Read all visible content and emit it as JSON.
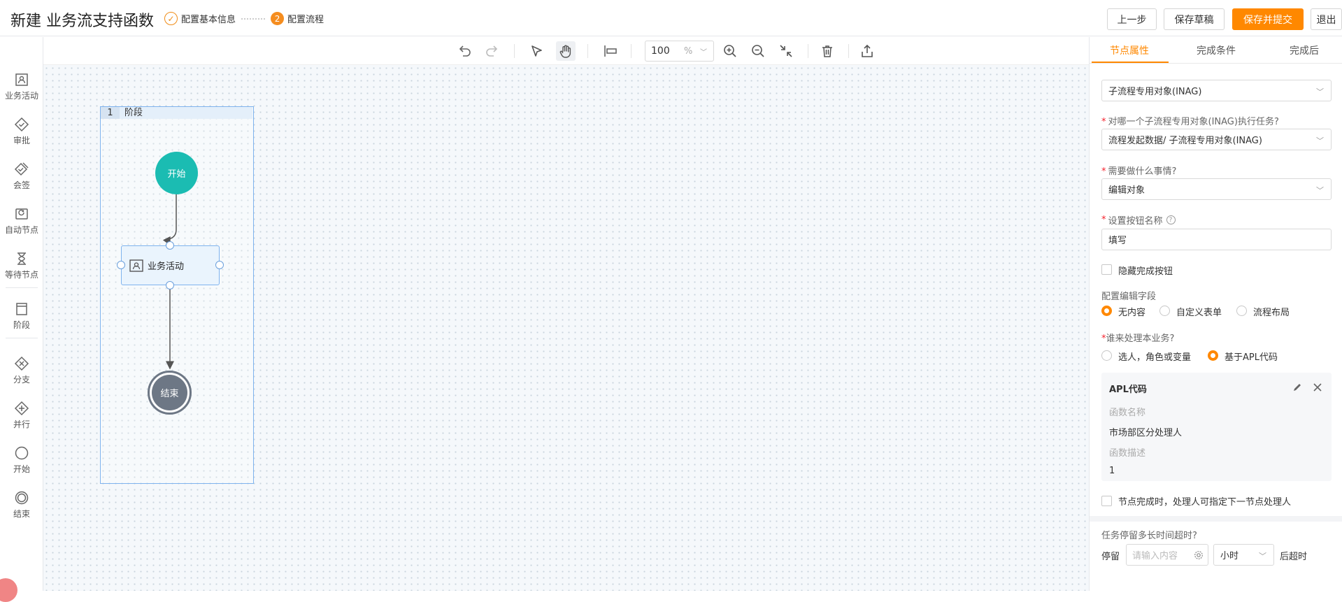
{
  "header": {
    "title": "新建 业务流支持函数",
    "steps": [
      {
        "label": "配置基本信息"
      },
      {
        "number": "2",
        "label": "配置流程"
      }
    ],
    "buttons": {
      "prev": "上一步",
      "save_draft": "保存草稿",
      "save_submit": "保存并提交",
      "exit": "退出"
    }
  },
  "toolbar": {
    "zoom_value": "100",
    "zoom_unit": "%"
  },
  "left_palette": [
    {
      "label": "业务活动",
      "icon": "activity-icon"
    },
    {
      "label": "审批",
      "icon": "approval-icon"
    },
    {
      "label": "会签",
      "icon": "countersign-icon"
    },
    {
      "label": "自动节点",
      "icon": "auto-node-icon"
    },
    {
      "label": "等待节点",
      "icon": "hourglass-icon"
    },
    {
      "label": "阶段",
      "icon": "stage-icon"
    },
    {
      "label": "分支",
      "icon": "branch-icon"
    },
    {
      "label": "并行",
      "icon": "parallel-icon"
    },
    {
      "label": "开始",
      "icon": "start-circle-icon"
    },
    {
      "label": "结束",
      "icon": "end-circle-icon"
    }
  ],
  "canvas": {
    "stage": {
      "index": "1",
      "label": "阶段"
    },
    "start_node": "开始",
    "activity_node": "业务活动",
    "end_node": "结束"
  },
  "panel": {
    "tabs": [
      "节点属性",
      "完成条件",
      "完成后"
    ],
    "object_type": "子流程专用对象(INAG)",
    "q_target": "对哪一个子流程专用对象(INAG)执行任务?",
    "target_value": "流程发起数据/ 子流程专用对象(INAG)",
    "q_action": "需要做什么事情?",
    "action_value": "编辑对象",
    "q_button_name": "设置按钮名称",
    "button_name_value": "填写",
    "hide_complete": "隐藏完成按钮",
    "edit_fields_label": "配置编辑字段",
    "edit_fields_options": [
      "无内容",
      "自定义表单",
      "流程布局"
    ],
    "edit_fields_selected": "无内容",
    "q_handler": "谁来处理本业务?",
    "handler_options": [
      "选人，角色或变量",
      "基于APL代码"
    ],
    "handler_selected": "基于APL代码",
    "apl": {
      "title": "APL代码",
      "name_label": "函数名称",
      "name_value": "市场部区分处理人",
      "desc_label": "函数描述",
      "desc_value": "1"
    },
    "next_handler": "节点完成时，处理人可指定下一节点处理人",
    "timeout_label": "任务停留多长时间超时?",
    "stay": "停留",
    "timeout_placeholder": "请输入内容",
    "unit": "小时",
    "after": "后超时"
  },
  "colors": {
    "accent": "#ff8800",
    "start": "#1bbcb2",
    "end": "#6d7785",
    "node_border": "#7fb3ee",
    "node_bg": "#eaf4fd"
  }
}
